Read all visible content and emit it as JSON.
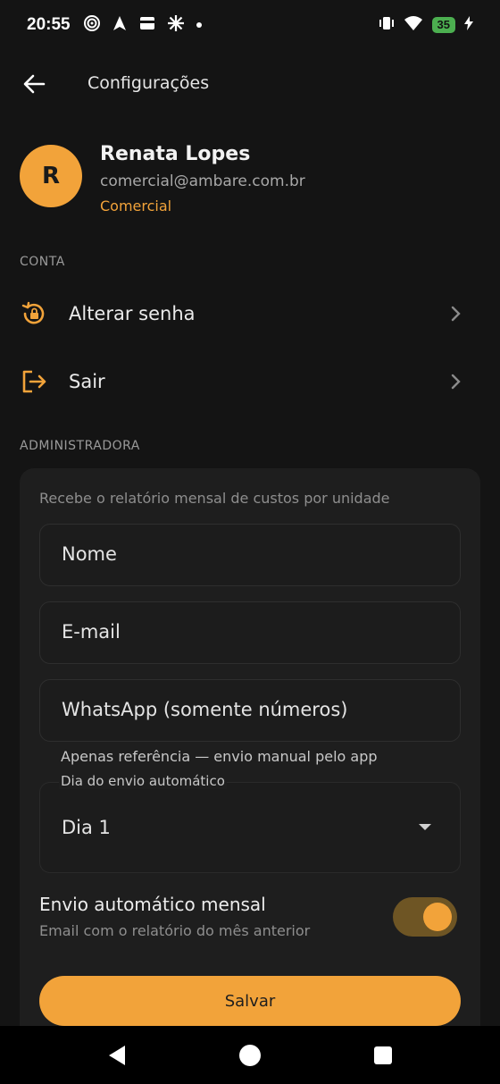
{
  "status_bar": {
    "time": "20:55",
    "battery": "35",
    "left_icons": [
      "wireless-signal-icon",
      "navigation-icon",
      "card-icon",
      "sparkle-icon",
      "dot-icon"
    ],
    "right_icons": [
      "vibrate-icon",
      "wifi-icon",
      "battery-icon",
      "charging-icon"
    ]
  },
  "app_bar": {
    "title": "Configurações",
    "back_icon": "arrow-left-icon"
  },
  "profile": {
    "initial": "R",
    "name": "Renata Lopes",
    "email": "comercial@ambare.com.br",
    "role": "Comercial"
  },
  "account_section": {
    "label": "CONTA",
    "items": [
      {
        "label": "Alterar senha",
        "icon": "lock-reset-icon"
      },
      {
        "label": "Sair",
        "icon": "logout-icon"
      }
    ]
  },
  "admin_section": {
    "label": "ADMINISTRADORA",
    "hint": "Recebe o relatório mensal de custos por unidade",
    "fields": {
      "name_placeholder": "Nome",
      "email_placeholder": "E-mail",
      "whatsapp_placeholder": "WhatsApp (somente números)"
    },
    "whatsapp_helper": "Apenas referência — envio manual pelo app",
    "dropdown": {
      "label": "Dia do envio automático",
      "value": "Dia 1"
    },
    "auto_send": {
      "title": "Envio automático mensal",
      "subtitle": "Email com o relatório do mês anterior",
      "enabled": true
    },
    "save_label": "Salvar"
  },
  "colors": {
    "accent": "#f2a33a",
    "background": "#141414",
    "card": "#1e1e1e"
  }
}
